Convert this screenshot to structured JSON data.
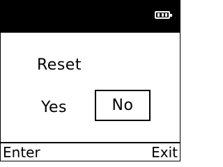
{
  "status_bar": {
    "battery_icon": "battery-full-icon",
    "background_color": "#000000"
  },
  "dialog": {
    "title": "Reset",
    "options": [
      "Yes",
      "No"
    ],
    "selected": "No"
  },
  "softkeys": {
    "left_label": "Enter",
    "right_label": "Exit"
  }
}
